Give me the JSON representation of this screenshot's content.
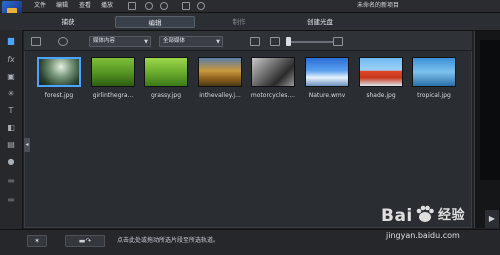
{
  "menu": {
    "items": [
      "文件",
      "编辑",
      "查看",
      "播放"
    ],
    "project_title": "未命名的新项目"
  },
  "modes": {
    "tabs": [
      "捕获",
      "编辑",
      "制作",
      "创建光盘"
    ],
    "active": "编辑"
  },
  "library": {
    "dropdown_media": "媒体内容",
    "dropdown_filter": "全部媒体",
    "items": [
      {
        "label": "forest.jpg"
      },
      {
        "label": "girlinthegra..."
      },
      {
        "label": "grassy.jpg"
      },
      {
        "label": "inthevalley.j..."
      },
      {
        "label": "motorcycles...."
      },
      {
        "label": "Nature.wmv"
      },
      {
        "label": "shade.jpg"
      },
      {
        "label": "tropical.jpg"
      }
    ]
  },
  "bottom": {
    "hint": "点击此处或拖动所选片段至所选轨道。"
  },
  "watermark": {
    "logo_text": "Bai",
    "logo_suffix": "经验",
    "url": "jingyan.baidu.com"
  },
  "colors": {
    "accent": "#4aa3ff",
    "background": "#1f2124"
  }
}
